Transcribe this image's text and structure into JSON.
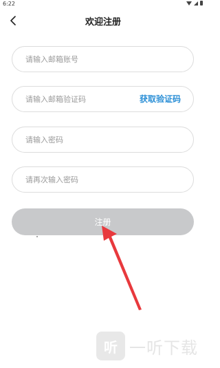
{
  "status_bar": {
    "time": "6:22"
  },
  "header": {
    "title": "欢迎注册"
  },
  "form": {
    "email_placeholder": "请输入邮箱账号",
    "code_placeholder": "请输入邮箱验证码",
    "get_code_label": "获取验证码",
    "password_placeholder": "请输入密码",
    "confirm_placeholder": "请再次输入密码",
    "register_label": "注册"
  },
  "watermark": {
    "logo_char": "听",
    "text": "一听下载"
  },
  "colors": {
    "link": "#2b8fd6",
    "button_disabled": "#c8c9cb",
    "arrow": "#e8393d"
  }
}
